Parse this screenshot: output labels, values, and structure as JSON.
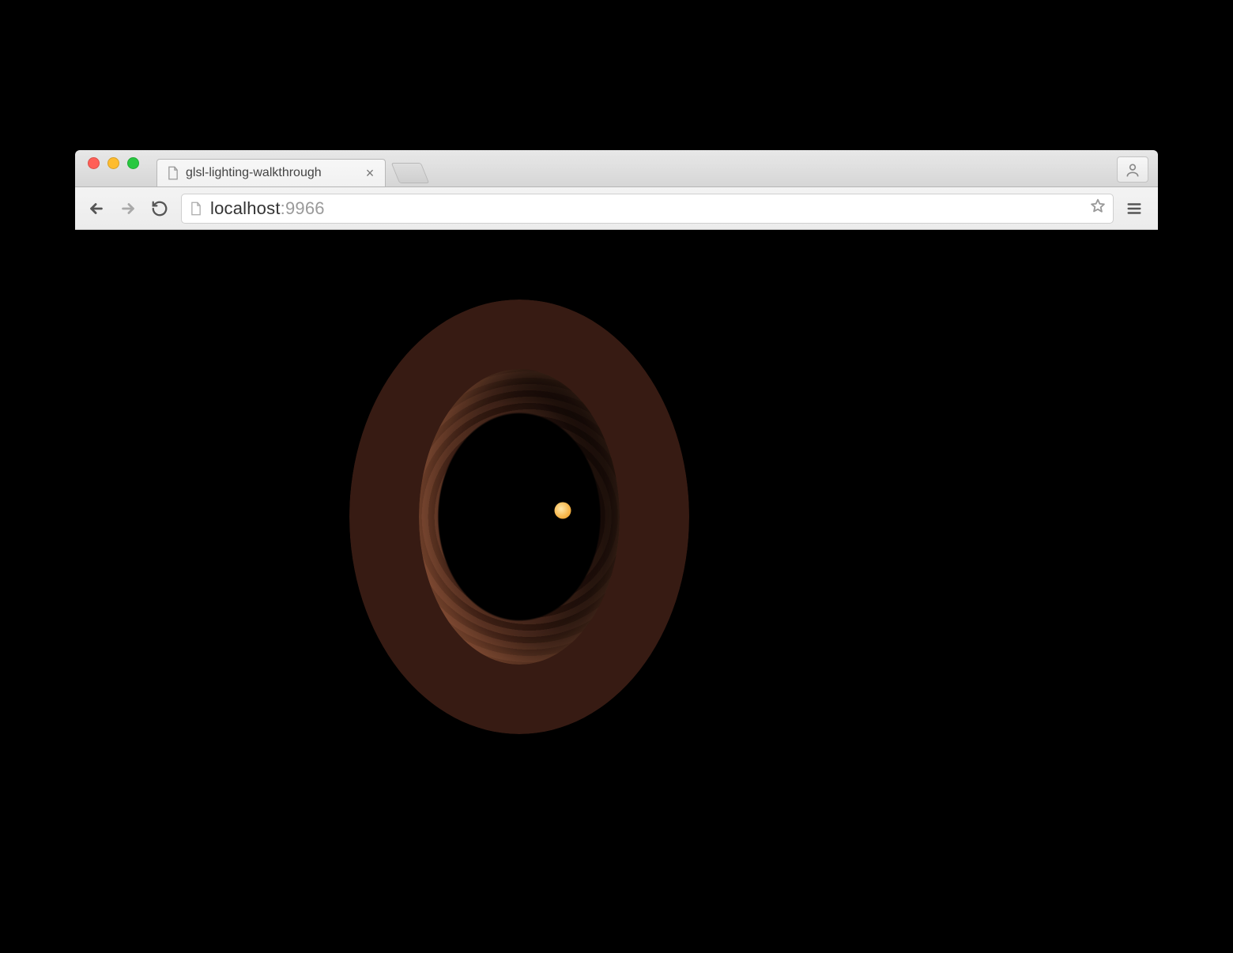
{
  "browser": {
    "tabs": [
      {
        "title": "glsl-lighting-walkthrough",
        "active": true
      }
    ],
    "address": {
      "host": "localhost",
      "port": ":9966"
    },
    "buttons": {
      "back": "Back",
      "forward": "Forward",
      "reload": "Reload",
      "bookmark": "Bookmark this page",
      "menu": "Menu",
      "profile": "Profile",
      "new_tab": "New Tab",
      "close_tab": "Close"
    }
  },
  "scene": {
    "description": "3D brick-textured torus lit by a warm point light",
    "light_color": "#f6b447",
    "background": "#000000"
  }
}
